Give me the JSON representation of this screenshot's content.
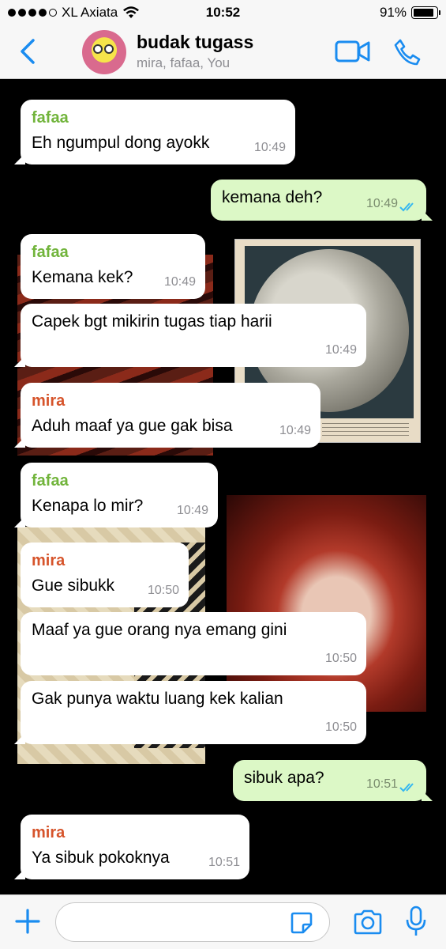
{
  "status_bar": {
    "carrier": "XL Axiata",
    "time": "10:52",
    "battery": "91%",
    "battery_level": 0.91,
    "signal_dots_filled": 4,
    "signal_dots_total": 5
  },
  "header": {
    "title": "budak tugass",
    "subtitle": "mira, fafaa, You",
    "accent_color": "#1a8cf0"
  },
  "messages": [
    {
      "direction": "in",
      "sender": "fafaa",
      "text": "Eh ngumpul dong ayokk",
      "time": "10:49"
    },
    {
      "direction": "out",
      "text": "kemana deh?",
      "time": "10:49",
      "status": "read"
    },
    {
      "direction": "in",
      "sender": "fafaa",
      "text": "Kemana kek?",
      "time": "10:49"
    },
    {
      "direction": "in",
      "sender": "",
      "text": "Capek bgt mikirin tugas tiap harii",
      "time": "10:49"
    },
    {
      "direction": "in",
      "sender": "mira",
      "text": "Aduh maaf ya gue gak bisa",
      "time": "10:49"
    },
    {
      "direction": "in",
      "sender": "fafaa",
      "text": "Kenapa lo mir?",
      "time": "10:49"
    },
    {
      "direction": "in",
      "sender": "mira",
      "text": "Gue sibukk",
      "time": "10:50"
    },
    {
      "direction": "in",
      "sender": "",
      "text": "Maaf ya gue orang nya emang gini",
      "time": "10:50"
    },
    {
      "direction": "in",
      "sender": "",
      "text": "Gak punya waktu luang kek kalian",
      "time": "10:50"
    },
    {
      "direction": "out",
      "text": "sibuk apa?",
      "time": "10:51",
      "status": "read"
    },
    {
      "direction": "in",
      "sender": "mira",
      "text": "Ya sibuk pokoknya",
      "time": "10:51"
    }
  ],
  "input": {
    "placeholder": "",
    "value": ""
  },
  "icons": {
    "back": "chevron-left-icon",
    "video": "video-camera-icon",
    "call": "phone-icon",
    "attach": "plus-icon",
    "sticker": "sticker-icon",
    "camera": "camera-icon",
    "mic": "microphone-icon"
  }
}
